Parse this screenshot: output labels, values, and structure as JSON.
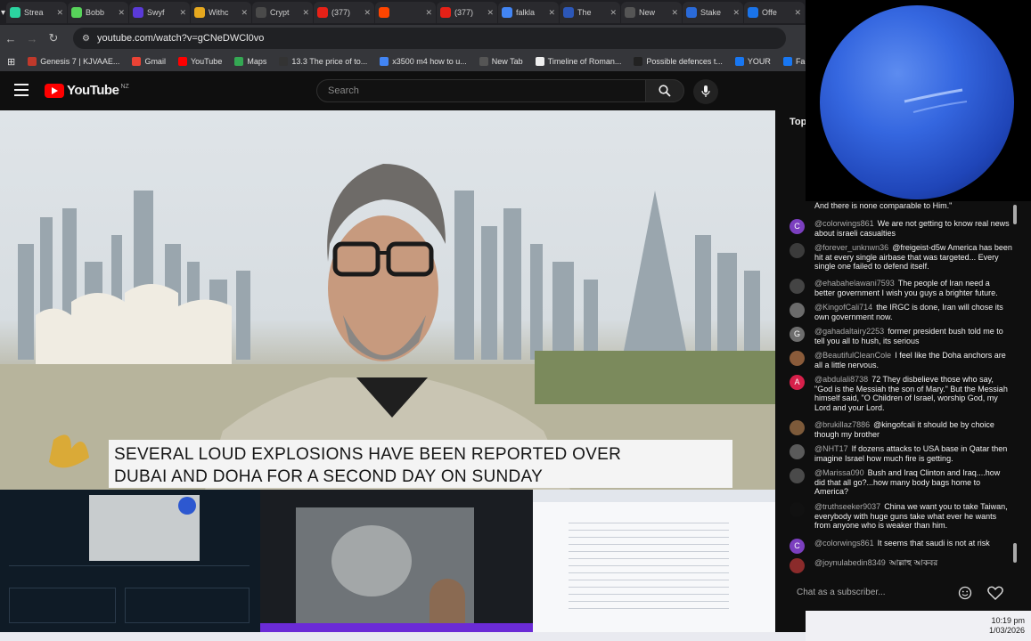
{
  "browser": {
    "tabs": [
      {
        "label": "Strea",
        "color": "#2bd4a0"
      },
      {
        "label": "Bobb",
        "color": "#57d35a"
      },
      {
        "label": "Swyf",
        "color": "#5a3ad8"
      },
      {
        "label": "Withc",
        "color": "#e6a81e"
      },
      {
        "label": "Crypt",
        "color": "#4a4a4a"
      },
      {
        "label": "(377)",
        "color": "#e62117"
      },
      {
        "label": "",
        "color": "#ff4500"
      },
      {
        "label": "(377)",
        "color": "#e62117"
      },
      {
        "label": "falkla",
        "color": "#4285f4"
      },
      {
        "label": "The",
        "color": "#2c57b8"
      },
      {
        "label": "New",
        "color": "#555"
      },
      {
        "label": "Stake",
        "color": "#2a6ad8"
      },
      {
        "label": "Offe",
        "color": "#1a73e8"
      }
    ],
    "url": "youtube.com/watch?v=gCNeDWCl0vo",
    "bookmarks": [
      {
        "label": "Genesis 7 | KJVAAE...",
        "color": "#c0392b"
      },
      {
        "label": "Gmail",
        "color": "#ea4335"
      },
      {
        "label": "YouTube",
        "color": "#ff0000"
      },
      {
        "label": "Maps",
        "color": "#34a853"
      },
      {
        "label": "13.3 The price of to...",
        "color": "#333"
      },
      {
        "label": "x3500 m4 how to u...",
        "color": "#4285f4"
      },
      {
        "label": "New Tab",
        "color": "#555"
      },
      {
        "label": "Timeline of Roman...",
        "color": "#eee"
      },
      {
        "label": "Possible defences t...",
        "color": "#222"
      },
      {
        "label": "YOUR",
        "color": "#1877f2"
      },
      {
        "label": "Facebook green",
        "color": "#1877f2"
      }
    ]
  },
  "youtube": {
    "logo_text": "YouTube",
    "country": "NZ",
    "search_placeholder": "Search"
  },
  "video": {
    "caption_line1": "SEVERAL LOUD EXPLOSIONS HAVE BEEN REPORTED OVER",
    "caption_line2": "DUBAI AND DOHA FOR A SECOND DAY ON SUNDAY"
  },
  "chat": {
    "header": "Top",
    "top_partial": "And there is none comparable to Him.\"",
    "messages": [
      {
        "user": "@colorwings861",
        "text": "We are not getting to know real news about israeli casualties",
        "initial": "C",
        "color": "#7b3fbf"
      },
      {
        "user": "@forever_unknwn36",
        "text": "@freigeist-d5w America has been hit at every single airbase that was targeted... Every single one failed to defend itself.",
        "initial": "",
        "color": "#3b3b3b"
      },
      {
        "user": "@ehabahelawani7593",
        "text": "The people of Iran need a better government I wish you guys a brighter future.",
        "initial": "",
        "color": "#444"
      },
      {
        "user": "@KingofCali714",
        "text": "the IRGC is done, Iran will chose its own government now.",
        "initial": "",
        "color": "#6b6b6b"
      },
      {
        "user": "@gahadaltairy2253",
        "text": "former president bush told me to tell you all to hush, its serious",
        "initial": "G",
        "color": "#6d6d6d"
      },
      {
        "user": "@BeautifulCleanCole",
        "text": "I feel like the Doha anchors are all a little nervous.",
        "initial": "",
        "color": "#8a5b3a"
      },
      {
        "user": "@abdulali8738",
        "text": "72  They disbelieve those who say, \"God is the Messiah the son of Mary.\" But the Messiah himself said, \"O Children of Israel, worship God, my Lord and your Lord.",
        "initial": "A",
        "color": "#d6204a"
      },
      {
        "user": "@brukillaz7886",
        "text": "@kingofcali it should be by choice though my brother",
        "initial": "",
        "color": "#7d5a3a"
      },
      {
        "user": "@NHT17",
        "text": "If dozens attacks to USA base in Qatar then imagine Israel how much fire is getting.",
        "initial": "",
        "color": "#5a5a5a"
      },
      {
        "user": "@Marissa090",
        "text": "Bush and Iraq Clinton and Iraq....how did that all go?...how many body bags home to America?",
        "initial": "",
        "color": "#4a4a4a"
      },
      {
        "user": "@truthseeker9037",
        "text": "China we want you to take Taiwan, everybody with huge guns take what ever he wants from anyone who is weaker than him.",
        "initial": "",
        "color": "#111"
      },
      {
        "user": "@colorwings861",
        "text": "It seems that saudi is not at risk",
        "initial": "C",
        "color": "#7b3fbf"
      },
      {
        "user": "@joynulabedin8349",
        "text": "আল্লাহু আকবর",
        "initial": "",
        "color": "#8b2b2b"
      }
    ],
    "input_placeholder": "Chat as a subscriber..."
  },
  "clock": {
    "time": "10:19 pm",
    "date": "1/03/2026"
  }
}
